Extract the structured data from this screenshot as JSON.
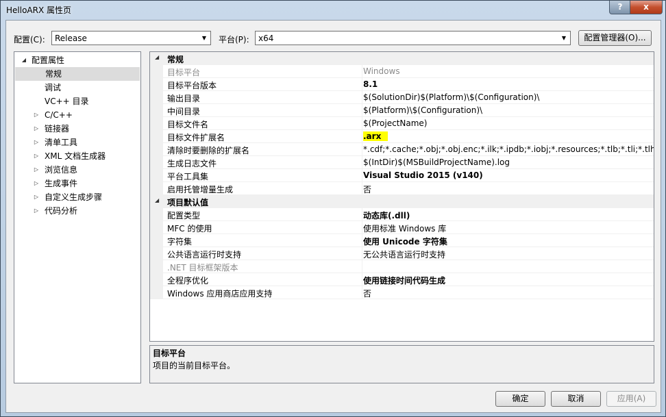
{
  "window": {
    "title": "HelloARX 属性页",
    "help_glyph": "?",
    "close_glyph": "x"
  },
  "toolbar": {
    "config_label": "配置(C):",
    "config_value": "Release",
    "platform_label": "平台(P):",
    "platform_value": "x64",
    "manager_button": "配置管理器(O)..."
  },
  "tree": [
    {
      "label": "配置属性",
      "expander": "◢",
      "level": 0
    },
    {
      "label": "常规",
      "expander": "",
      "level": 1,
      "selected": true
    },
    {
      "label": "调试",
      "expander": "",
      "level": 1
    },
    {
      "label": "VC++ 目录",
      "expander": "",
      "level": 1
    },
    {
      "label": "C/C++",
      "expander": "▷",
      "level": 1
    },
    {
      "label": "链接器",
      "expander": "▷",
      "level": 1
    },
    {
      "label": "清单工具",
      "expander": "▷",
      "level": 1
    },
    {
      "label": "XML 文档生成器",
      "expander": "▷",
      "level": 1
    },
    {
      "label": "浏览信息",
      "expander": "▷",
      "level": 1
    },
    {
      "label": "生成事件",
      "expander": "▷",
      "level": 1
    },
    {
      "label": "自定义生成步骤",
      "expander": "▷",
      "level": 1
    },
    {
      "label": "代码分析",
      "expander": "▷",
      "level": 1
    }
  ],
  "grid": [
    {
      "type": "cat",
      "name": "常规",
      "expander": "◢"
    },
    {
      "name": "目标平台",
      "value": "Windows",
      "disabled": true
    },
    {
      "name": "目标平台版本",
      "value": "8.1",
      "bold": true
    },
    {
      "name": "输出目录",
      "value": "$(SolutionDir)$(Platform)\\$(Configuration)\\"
    },
    {
      "name": "中间目录",
      "value": "$(Platform)\\$(Configuration)\\"
    },
    {
      "name": "目标文件名",
      "value": "$(ProjectName)"
    },
    {
      "name": "目标文件扩展名",
      "value": ".arx",
      "bold": true,
      "highlight": true
    },
    {
      "name": "清除时要删除的扩展名",
      "value": "*.cdf;*.cache;*.obj;*.obj.enc;*.ilk;*.ipdb;*.iobj;*.resources;*.tlb;*.tli;*.tlh;*.tmp;"
    },
    {
      "name": "生成日志文件",
      "value": "$(IntDir)$(MSBuildProjectName).log"
    },
    {
      "name": "平台工具集",
      "value": "Visual Studio 2015 (v140)",
      "bold": true
    },
    {
      "name": "启用托管增量生成",
      "value": "否"
    },
    {
      "type": "cat",
      "name": "项目默认值",
      "expander": "◢"
    },
    {
      "name": "配置类型",
      "value": "动态库(.dll)",
      "bold": true
    },
    {
      "name": "MFC 的使用",
      "value": "使用标准 Windows 库"
    },
    {
      "name": "字符集",
      "value": "使用 Unicode 字符集",
      "bold": true
    },
    {
      "name": "公共语言运行时支持",
      "value": "无公共语言运行时支持"
    },
    {
      "name": ".NET 目标框架版本",
      "value": "",
      "disabled": true
    },
    {
      "name": "全程序优化",
      "value": "使用链接时间代码生成",
      "bold": true
    },
    {
      "name": "Windows 应用商店应用支持",
      "value": "否"
    }
  ],
  "description": {
    "title": "目标平台",
    "text": "项目的当前目标平台。"
  },
  "buttons": {
    "ok": "确定",
    "cancel": "取消",
    "apply": "应用(A)"
  }
}
